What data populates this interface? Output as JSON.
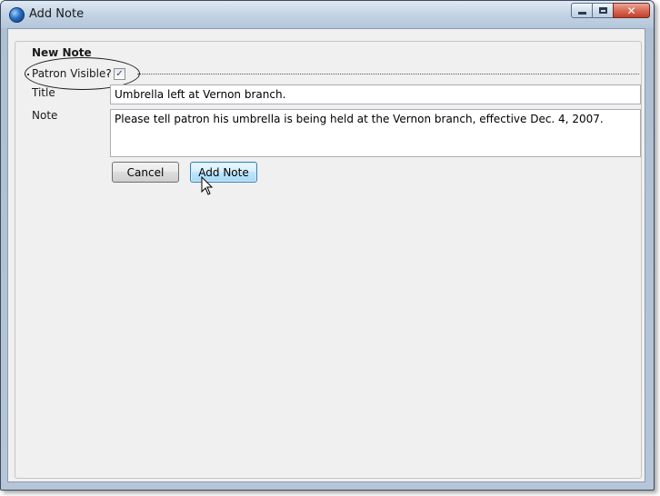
{
  "window": {
    "title": "Add Note",
    "controls": {
      "minimize_icon": "minimize-icon",
      "maximize_icon": "maximize-icon",
      "close_icon": "close-icon",
      "close_glyph": "✕"
    }
  },
  "group": {
    "legend": "New Note"
  },
  "patron_visible": {
    "label": "Patron Visible?",
    "checked": true,
    "check_glyph": "✓"
  },
  "fields": {
    "title_label": "Title",
    "title_value": "Umbrella left at Vernon branch.",
    "note_label": "Note",
    "note_value": "Please tell patron his umbrella is being held at the Vernon branch, effective Dec. 4, 2007."
  },
  "buttons": {
    "cancel_label": "Cancel",
    "add_note_label": "Add Note"
  },
  "colors": {
    "titlebar": "#c3d3e4",
    "client_bg": "#f0f0f0",
    "close_button": "#d86b56",
    "default_button_accent": "#3c7fb1"
  }
}
